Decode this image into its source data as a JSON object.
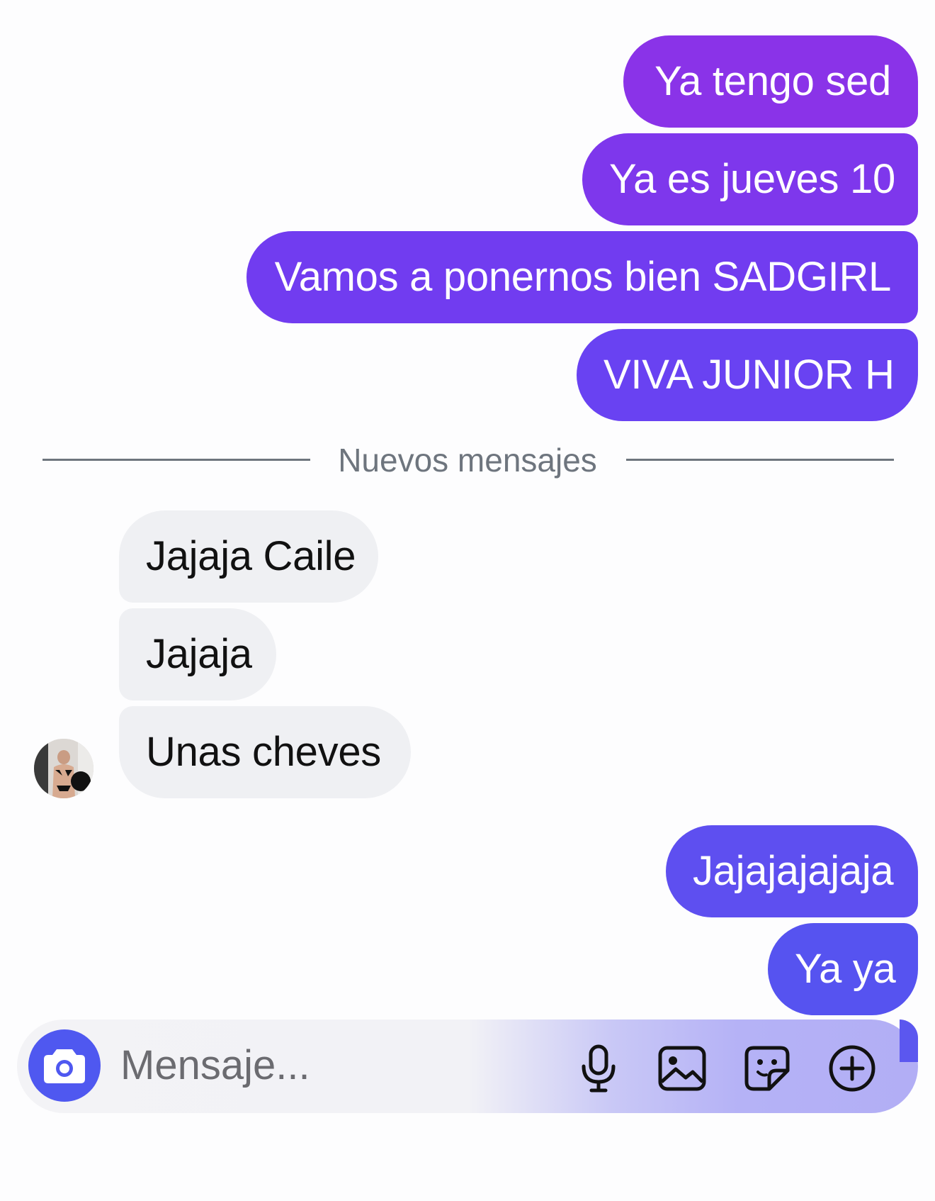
{
  "chat": {
    "outgoing_top": [
      {
        "text": "Ya tengo sed"
      },
      {
        "text": "Ya es jueves 10"
      },
      {
        "text": "Vamos a ponernos bien SADGIRL"
      },
      {
        "text": "VIVA JUNIOR H"
      }
    ],
    "divider": {
      "label": "Nuevos mensajes"
    },
    "incoming": [
      {
        "text": "Jajaja Caile"
      },
      {
        "text": "Jajaja"
      },
      {
        "text": "Unas cheves"
      }
    ],
    "outgoing_bottom": [
      {
        "text": "Jajajajajaja"
      },
      {
        "text": "Ya ya"
      }
    ]
  },
  "composer": {
    "placeholder": "Mensaje...",
    "icons": [
      "camera-icon",
      "microphone-icon",
      "image-icon",
      "sticker-icon",
      "add-circle-icon"
    ]
  },
  "colors": {
    "bubble_top": "#8a33e8",
    "bubble_mid": "#6f3df2",
    "bubble_bottom": "#5653f0",
    "incoming_bubble": "#eff0f3",
    "camera_button": "#4f58f0",
    "divider": "#6e757e"
  }
}
